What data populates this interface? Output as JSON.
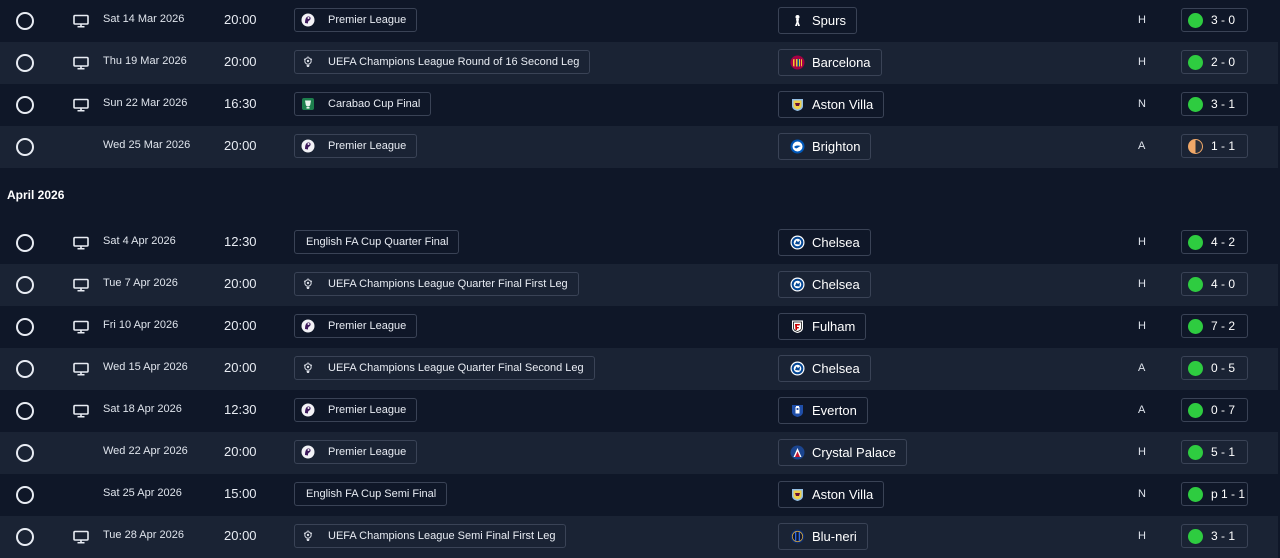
{
  "months": [
    {
      "title": "",
      "fixtures": [
        {
          "date": "Sat 14 Mar 2026",
          "time": "20:00",
          "tv": true,
          "competition": "Premier League",
          "comp_icon": "premier-league-icon",
          "team": "Spurs",
          "crest": "spurs-crest-icon",
          "venue": "H",
          "result": "3 - 0",
          "outcome": "win"
        },
        {
          "date": "Thu 19 Mar 2026",
          "time": "20:00",
          "tv": true,
          "competition": "UEFA Champions League Round of 16  Second Leg",
          "comp_icon": "champions-league-icon",
          "team": "Barcelona",
          "crest": "barcelona-crest-icon",
          "venue": "H",
          "result": "2 - 0",
          "outcome": "win"
        },
        {
          "date": "Sun 22 Mar 2026",
          "time": "16:30",
          "tv": true,
          "competition": "Carabao Cup Final",
          "comp_icon": "carabao-cup-icon",
          "team": "Aston Villa",
          "crest": "aston-villa-crest-icon",
          "venue": "N",
          "result": "3 - 1",
          "outcome": "win"
        },
        {
          "date": "Wed 25 Mar 2026",
          "time": "20:00",
          "tv": false,
          "competition": "Premier League",
          "comp_icon": "premier-league-icon",
          "team": "Brighton",
          "crest": "brighton-crest-icon",
          "venue": "A",
          "result": "1 - 1",
          "outcome": "draw"
        }
      ]
    },
    {
      "title": "April 2026",
      "fixtures": [
        {
          "date": "Sat 4 Apr 2026",
          "time": "12:30",
          "tv": true,
          "competition": "English FA Cup Quarter Final",
          "comp_icon": "",
          "team": "Chelsea",
          "crest": "chelsea-crest-icon",
          "venue": "H",
          "result": "4 - 2",
          "outcome": "win"
        },
        {
          "date": "Tue 7 Apr 2026",
          "time": "20:00",
          "tv": true,
          "competition": "UEFA Champions League Quarter Final First Leg",
          "comp_icon": "champions-league-icon",
          "team": "Chelsea",
          "crest": "chelsea-crest-icon",
          "venue": "H",
          "result": "4 - 0",
          "outcome": "win"
        },
        {
          "date": "Fri 10 Apr 2026",
          "time": "20:00",
          "tv": true,
          "competition": "Premier League",
          "comp_icon": "premier-league-icon",
          "team": "Fulham",
          "crest": "fulham-crest-icon",
          "venue": "H",
          "result": "7 - 2",
          "outcome": "win"
        },
        {
          "date": "Wed 15 Apr 2026",
          "time": "20:00",
          "tv": true,
          "competition": "UEFA Champions League Quarter Final Second Leg",
          "comp_icon": "champions-league-icon",
          "team": "Chelsea",
          "crest": "chelsea-crest-icon",
          "venue": "A",
          "result": "0 - 5",
          "outcome": "win"
        },
        {
          "date": "Sat 18 Apr 2026",
          "time": "12:30",
          "tv": true,
          "competition": "Premier League",
          "comp_icon": "premier-league-icon",
          "team": "Everton",
          "crest": "everton-crest-icon",
          "venue": "A",
          "result": "0 - 7",
          "outcome": "win"
        },
        {
          "date": "Wed 22 Apr 2026",
          "time": "20:00",
          "tv": false,
          "competition": "Premier League",
          "comp_icon": "premier-league-icon",
          "team": "Crystal Palace",
          "crest": "crystal-palace-crest-icon",
          "venue": "H",
          "result": "5 - 1",
          "outcome": "win"
        },
        {
          "date": "Sat 25 Apr 2026",
          "time": "15:00",
          "tv": false,
          "competition": "English FA Cup Semi Final",
          "comp_icon": "",
          "team": "Aston Villa",
          "crest": "aston-villa-crest-icon",
          "venue": "N",
          "result": "p 1 - 1",
          "outcome": "win"
        },
        {
          "date": "Tue 28 Apr 2026",
          "time": "20:00",
          "tv": true,
          "competition": "UEFA Champions League Semi Final First Leg",
          "comp_icon": "champions-league-icon",
          "team": "Blu-neri",
          "crest": "blu-neri-crest-icon",
          "venue": "H",
          "result": "3 - 1",
          "outcome": "win"
        }
      ]
    }
  ],
  "colors": {
    "background": "#0f1728",
    "row_alt": "#1a2334",
    "win": "#2ecc40",
    "draw": "#f0a868",
    "border": "#3a4356"
  }
}
